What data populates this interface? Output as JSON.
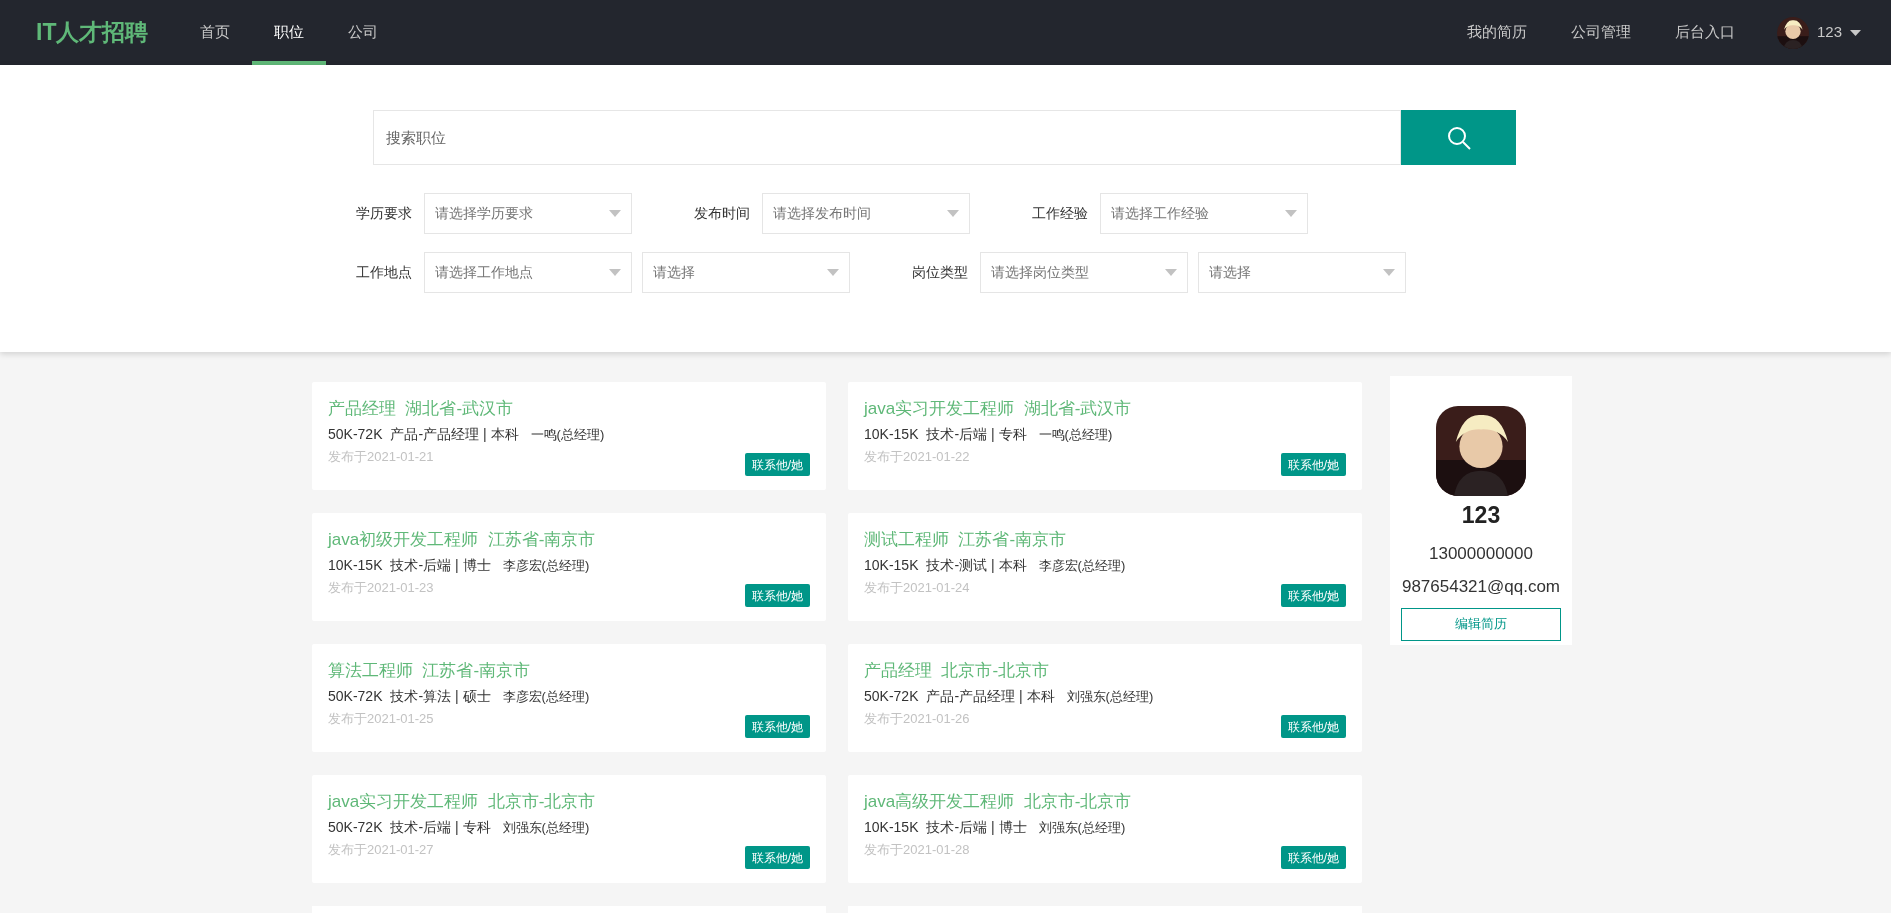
{
  "navbar": {
    "logo": "IT人才招聘",
    "links": [
      {
        "label": "首页",
        "selected": false
      },
      {
        "label": "职位",
        "selected": true
      },
      {
        "label": "公司",
        "selected": false
      }
    ],
    "right_links": [
      "我的简历",
      "公司管理",
      "后台入口"
    ],
    "user": "123"
  },
  "search": {
    "placeholder": "搜索职位"
  },
  "filters": [
    {
      "label": "学历要求",
      "selects": [
        "请选择学历要求"
      ]
    },
    {
      "label": "发布时间",
      "selects": [
        "请选择发布时间"
      ]
    },
    {
      "label": "工作经验",
      "selects": [
        "请选择工作经验"
      ]
    },
    {
      "label": "工作地点",
      "selects": [
        "请选择工作地点",
        "请选择"
      ]
    },
    {
      "label": "岗位类型",
      "selects": [
        "请选择岗位类型",
        "请选择"
      ]
    }
  ],
  "jobs": [
    {
      "title": "产品经理",
      "location": "湖北省-武汉市",
      "salary": "50K-72K",
      "category": "产品-产品经理 | 本科",
      "contact": "一鸣(总经理)",
      "date": "发布于2021-01-21",
      "button": "联系他/她"
    },
    {
      "title": "java实习开发工程师",
      "location": "湖北省-武汉市",
      "salary": "10K-15K",
      "category": "技术-后端 | 专科",
      "contact": "一鸣(总经理)",
      "date": "发布于2021-01-22",
      "button": "联系他/她"
    },
    {
      "title": "java初级开发工程师",
      "location": "江苏省-南京市",
      "salary": "10K-15K",
      "category": "技术-后端 | 博士",
      "contact": "李彦宏(总经理)",
      "date": "发布于2021-01-23",
      "button": "联系他/她"
    },
    {
      "title": "测试工程师",
      "location": "江苏省-南京市",
      "salary": "10K-15K",
      "category": "技术-测试 | 本科",
      "contact": "李彦宏(总经理)",
      "date": "发布于2021-01-24",
      "button": "联系他/她"
    },
    {
      "title": "算法工程师",
      "location": "江苏省-南京市",
      "salary": "50K-72K",
      "category": "技术-算法 | 硕士",
      "contact": "李彦宏(总经理)",
      "date": "发布于2021-01-25",
      "button": "联系他/她"
    },
    {
      "title": "产品经理",
      "location": "北京市-北京市",
      "salary": "50K-72K",
      "category": "产品-产品经理 | 本科",
      "contact": "刘强东(总经理)",
      "date": "发布于2021-01-26",
      "button": "联系他/她"
    },
    {
      "title": "java实习开发工程师",
      "location": "北京市-北京市",
      "salary": "50K-72K",
      "category": "技术-后端 | 专科",
      "contact": "刘强东(总经理)",
      "date": "发布于2021-01-27",
      "button": "联系他/她"
    },
    {
      "title": "java高级开发工程师",
      "location": "北京市-北京市",
      "salary": "10K-15K",
      "category": "技术-后端 | 博士",
      "contact": "刘强东(总经理)",
      "date": "发布于2021-01-28",
      "button": "联系他/她"
    }
  ],
  "profile": {
    "name": "123",
    "phone": "13000000000",
    "email": "987654321@qq.com",
    "button": "编辑简历"
  }
}
